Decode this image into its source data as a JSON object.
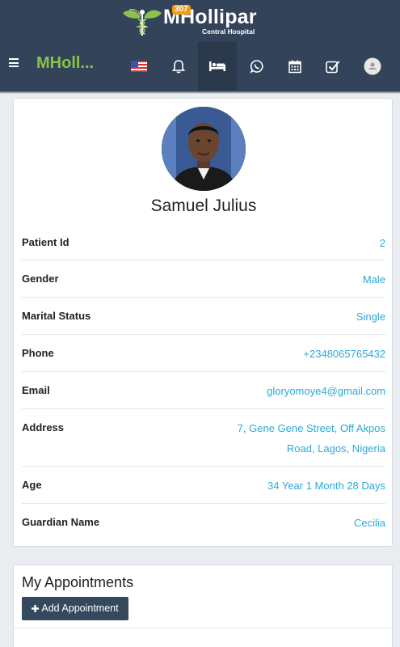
{
  "brand": {
    "name": "MHollipar",
    "subtitle": "Central Hospital"
  },
  "navbar": {
    "title": "MHoll...",
    "notification_count": "307",
    "icons": [
      "menu-icon",
      "us-flag-icon",
      "bell-icon",
      "bed-icon",
      "whatsapp-icon",
      "calendar-icon",
      "checkbox-icon",
      "user-avatar-icon"
    ]
  },
  "profile": {
    "name": "Samuel Julius",
    "rows": [
      {
        "label": "Patient Id",
        "value": "2"
      },
      {
        "label": "Gender",
        "value": "Male"
      },
      {
        "label": "Marital Status",
        "value": "Single"
      },
      {
        "label": "Phone",
        "value": "+2348065765432"
      },
      {
        "label": "Email",
        "value": "gloryomoye4@gmail.com"
      },
      {
        "label": "Address",
        "value_line1": "7, Gene Gene Street, Off Akpos",
        "value_line2": "Road, Lagos, Nigeria"
      },
      {
        "label": "Age",
        "value": "34 Year 1 Month 28 Days"
      },
      {
        "label": "Guardian Name",
        "value": "Cecilia"
      }
    ]
  },
  "appointments": {
    "title": "My Appointments",
    "add_button": "Add Appointment"
  },
  "colors": {
    "header_bg": "#33435a",
    "accent_green": "#8bc34a",
    "link_blue": "#2ea8d6",
    "badge_orange": "#f39c12",
    "button_dark": "#34495e"
  }
}
